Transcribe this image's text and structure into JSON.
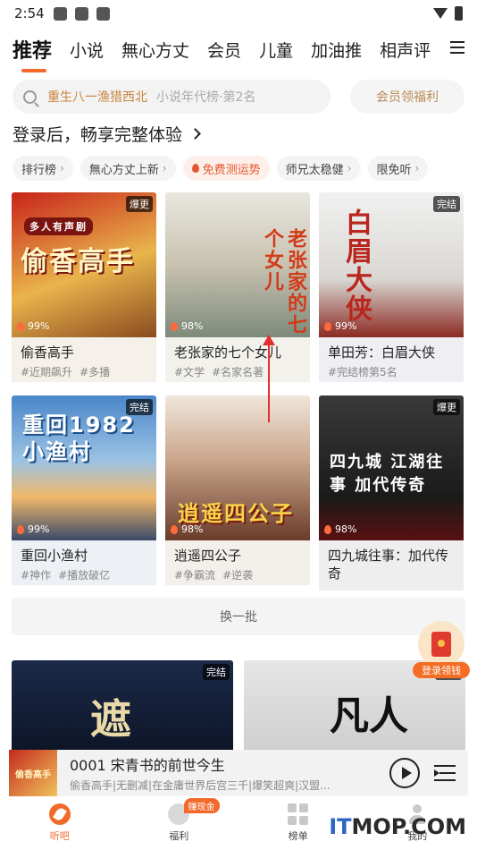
{
  "status_bar": {
    "time": "2:54"
  },
  "top_tabs": [
    "推荐",
    "小说",
    "無心方丈",
    "会员",
    "儿童",
    "加油推",
    "相声评"
  ],
  "search": {
    "hot_term": "重生八一渔猎西北",
    "hint": "小说年代榜·第2名",
    "vip_label": "会员领福利"
  },
  "login_prompt": "登录后，畅享完整体验",
  "chips": [
    {
      "label": "排行榜",
      "arrow": "›"
    },
    {
      "label": "無心方丈上新",
      "arrow": "›"
    },
    {
      "label": "免费测运势",
      "arrow": ""
    },
    {
      "label": "师兄太稳健",
      "arrow": "›"
    },
    {
      "label": "限免听",
      "arrow": "›"
    }
  ],
  "cards": [
    {
      "title": "偷香高手",
      "tags": [
        "#近期飙升",
        "#多播"
      ],
      "badge": "爆更",
      "rating": "99%",
      "cover_text": "偷香高手",
      "cover_sub": "多人有声剧"
    },
    {
      "title": "老张家的七个女儿",
      "tags": [
        "#文学",
        "#名家名著"
      ],
      "badge": "",
      "rating": "98%",
      "cover_text": "老张家的七个女儿",
      "cover_sub": ""
    },
    {
      "title": "单田芳：白眉大侠",
      "tags": [
        "#完结榜第5名"
      ],
      "badge": "完结",
      "rating": "99%",
      "cover_text": "白眉大侠",
      "cover_sub": ""
    },
    {
      "title": "重回小渔村",
      "tags": [
        "#神作",
        "#播放破亿"
      ],
      "badge": "完结",
      "rating": "99%",
      "cover_text": "重回1982小渔村",
      "cover_sub": ""
    },
    {
      "title": "逍遥四公子",
      "tags": [
        "#争霸流",
        "#逆袭"
      ],
      "badge": "",
      "rating": "98%",
      "cover_text": "逍遥四公子",
      "cover_sub": ""
    },
    {
      "title": "四九城往事：加代传奇",
      "tags": [],
      "badge": "爆更",
      "rating": "98%",
      "cover_text": "四九城 江湖往事 加代传奇",
      "cover_sub": ""
    }
  ],
  "refresh_label": "换一批",
  "float_gift_label": "登录领钱",
  "bottom_covers": [
    {
      "badge": "完结",
      "cover_text": "遮"
    },
    {
      "badge": "完结",
      "cover_text": "凡人"
    }
  ],
  "player": {
    "title": "0001 宋青书的前世今生",
    "subtitle": "偷香高手|无删减|在金庸世界后宫三千|爆笑超爽|汉盟...",
    "thumb_text": "偷香高手"
  },
  "bottom_nav": [
    {
      "label": "听吧",
      "active": true
    },
    {
      "label": "福利",
      "active": false,
      "badge": "赚现金"
    },
    {
      "label": "榜单",
      "active": false
    },
    {
      "label": "我的",
      "active": false
    }
  ],
  "watermark": {
    "part1": "IT",
    "part2": "MOP.COM"
  },
  "colors": {
    "accent": "#f26a2a",
    "hot": "#e4572e",
    "vip": "#b88a55"
  }
}
